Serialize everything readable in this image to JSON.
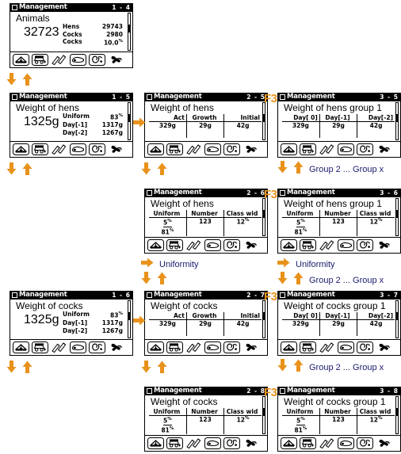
{
  "theme": {
    "arrow_color": "#E8921C",
    "label_color": "#1a1a6e",
    "lcd_bg": "#ffffff",
    "lcd_fg": "#000000"
  },
  "window_title": "Management",
  "panels": [
    {
      "id": "p1",
      "title": "Management",
      "page": "1 - 4",
      "heading": "Animals",
      "layout": "big",
      "big_value": "32723",
      "rows": [
        {
          "key": "Hens",
          "value": "29743",
          "unit": ""
        },
        {
          "key": "Cocks",
          "value": "2980",
          "unit": ""
        },
        {
          "key": "Cocks",
          "value": "10.0",
          "unit": "%"
        }
      ]
    },
    {
      "id": "p2",
      "title": "Management",
      "page": "1 - 5",
      "heading": "Weight of hens",
      "layout": "big",
      "big_value": "1325g",
      "rows": [
        {
          "key": "Uniform",
          "value": "83",
          "unit": "%"
        },
        {
          "key": "Day[-1]",
          "value": "1317g",
          "unit": ""
        },
        {
          "key": "Day[-2]",
          "value": "1267g",
          "unit": ""
        }
      ]
    },
    {
      "id": "p3",
      "title": "Management",
      "page": "1 - 6",
      "heading": "Weight of cocks",
      "layout": "big",
      "big_value": "1325g",
      "rows": [
        {
          "key": "Uniform",
          "value": "83",
          "unit": "%"
        },
        {
          "key": "Day[-1]",
          "value": "1317g",
          "unit": ""
        },
        {
          "key": "Day[-2]",
          "value": "1267g",
          "unit": ""
        }
      ]
    },
    {
      "id": "p4",
      "title": "Management",
      "page": "2 - 5",
      "heading": "Weight of hens",
      "layout": "table",
      "columns": [
        "Act",
        "Growth",
        "Initial"
      ],
      "values": [
        "329g",
        "29g",
        "42g"
      ]
    },
    {
      "id": "p5",
      "title": "Management",
      "page": "2 - 6",
      "heading": "Weight of hens",
      "layout": "table-uniform",
      "columns": [
        "Uniform",
        "Number",
        "Class wid"
      ],
      "values": [
        "5",
        "123",
        "12"
      ],
      "uniform_second": "81",
      "unit_first": "%",
      "unit_last": "%"
    },
    {
      "id": "p6",
      "title": "Management",
      "page": "2 - 7",
      "heading": "Weight of cocks",
      "layout": "table",
      "columns": [
        "Act",
        "Growth",
        "Initial"
      ],
      "values": [
        "329g",
        "29g",
        "42g"
      ]
    },
    {
      "id": "p7",
      "title": "Management",
      "page": "2 - 8",
      "heading": "Weight of cocks",
      "layout": "table-uniform",
      "columns": [
        "Uniform",
        "Number",
        "Class wid"
      ],
      "values": [
        "5",
        "123",
        "12"
      ],
      "uniform_second": "81",
      "unit_first": "%",
      "unit_last": "%"
    },
    {
      "id": "p8",
      "title": "Management",
      "page": "3 - 5",
      "heading": "Weight of hens group 1",
      "layout": "table",
      "columns": [
        "Day[ 0]",
        "Day[-1]",
        "Day[-2]"
      ],
      "values": [
        "329g",
        "29g",
        "42g"
      ]
    },
    {
      "id": "p9",
      "title": "Management",
      "page": "3 - 6",
      "heading": "Weight of hens group 1",
      "layout": "table-uniform",
      "columns": [
        "Uniform",
        "Number",
        "Class wid"
      ],
      "values": [
        "5",
        "123",
        "12"
      ],
      "uniform_second": "81",
      "unit_first": "%",
      "unit_last": "%"
    },
    {
      "id": "p10",
      "title": "Management",
      "page": "3 - 7",
      "heading": "Weight of cocks group 1",
      "layout": "table",
      "columns": [
        "Day[ 0]",
        "Day[-1]",
        "Day[-2]"
      ],
      "values": [
        "329g",
        "29g",
        "42g"
      ]
    },
    {
      "id": "p11",
      "title": "Management",
      "page": "3 - 8",
      "heading": "Weight of cocks group 1",
      "layout": "table-uniform",
      "columns": [
        "Uniform",
        "Number",
        "Class wid"
      ],
      "values": [
        "5",
        "123",
        "12"
      ],
      "uniform_second": "81",
      "unit_first": "%",
      "unit_last": "%"
    }
  ],
  "icon_bar": [
    "house-icon",
    "feed-scale-icon",
    "pencils-icon",
    "egg-icon",
    "bird-icon",
    "fan-icon"
  ],
  "connectors": {
    "f_key": "F3",
    "group_label": "Group 2 ... Group x",
    "uniformity_label": "Uniformity"
  }
}
